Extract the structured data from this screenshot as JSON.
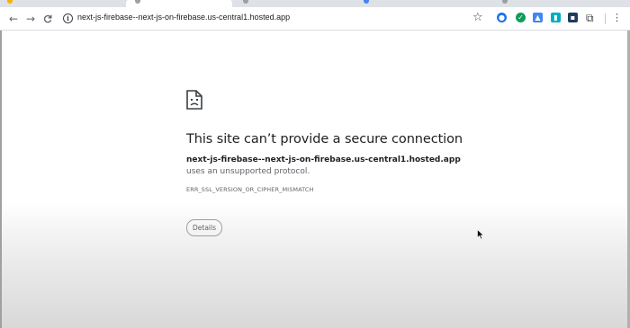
{
  "browser": {
    "url": "next-js-firebase--next-js-on-firebase.us-central1.hosted.app",
    "nav": {
      "back_icon": "←",
      "forward_icon": "→",
      "reload_icon": "C"
    },
    "icons": {
      "info": "i",
      "star": "☆",
      "extensions": "⧉",
      "menu": "⋮"
    }
  },
  "error_page": {
    "title": "This site can’t provide a secure connection",
    "host": "next-js-firebase--next-js-on-firebase.us-central1.hosted.app",
    "message_suffix": " uses an unsupported protocol.",
    "error_code": "ERR_SSL_VERSION_OR_CIPHER_MISMATCH",
    "details_label": "Details"
  },
  "colors": {
    "accent": "#1a73e8",
    "text": "#202124",
    "muted": "#5f6368"
  }
}
